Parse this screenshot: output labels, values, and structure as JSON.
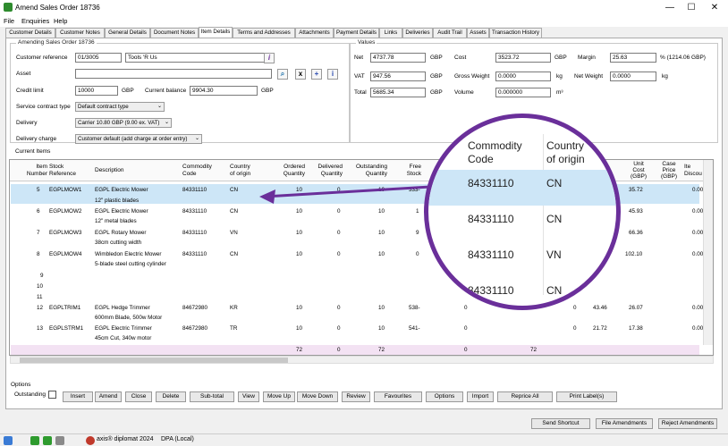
{
  "window": {
    "title": "Amend Sales Order 18736",
    "min": "—",
    "max": "☐",
    "close": "✕"
  },
  "menu": [
    "File",
    "Enquiries",
    "Help"
  ],
  "tabs": [
    "Customer Details",
    "Customer Notes",
    "General Details",
    "Document Notes",
    "Item Details",
    "Terms and Addresses",
    "Attachments",
    "Payment Details",
    "Links",
    "Deliveries",
    "Audit Trail",
    "Assets",
    "Transaction History"
  ],
  "amending": {
    "group_label": "Amending Sales Order 18736",
    "customer_reference_label": "Customer reference",
    "customer_reference": "01/3005",
    "customer_name": "Tools 'R Us",
    "asset_label": "Asset",
    "credit_limit_label": "Credit limit",
    "credit_limit": "10000",
    "credit_currency": "GBP",
    "current_balance_label": "Current balance",
    "current_balance": "9904.30",
    "balance_currency": "GBP",
    "service_contract_label": "Service contract type",
    "service_contract": "Default contract type",
    "delivery_label": "Delivery",
    "delivery": "Carrier 10.80 GBP (9.00 ex. VAT)",
    "delivery_charge_label": "Delivery charge",
    "delivery_charge": "Customer default (add charge at order entry)"
  },
  "values": {
    "group_label": "Values",
    "net_label": "Net",
    "net": "4737.78",
    "net_cur": "GBP",
    "vat_label": "VAT",
    "vat": "947.56",
    "vat_cur": "GBP",
    "total_label": "Total",
    "total": "5685.34",
    "total_cur": "GBP",
    "cost_label": "Cost",
    "cost": "3523.72",
    "cost_cur": "GBP",
    "gross_weight_label": "Gross Weight",
    "gross_weight": "0.0000",
    "gross_unit": "kg",
    "volume_label": "Volume",
    "volume": "0.000000",
    "volume_unit": "m³",
    "margin_label": "Margin",
    "margin": "25.63",
    "margin_extra": "% (1214.06 GBP)",
    "net_weight_label": "Net Weight",
    "net_weight": "0.0000",
    "net_unit": "kg"
  },
  "grid": {
    "label": "Current Items",
    "headers": {
      "item": "Item\nNumber",
      "stock": "Stock\nReference",
      "desc": "Description",
      "commodity": "Commodity\nCode",
      "country": "Country\nof origin",
      "ordered": "Ordered\nQuantity",
      "delivered": "Delivered\nQuantity",
      "outstanding": "Outstanding\nQuantity",
      "free": "Free\nStock",
      "unitcost": "Unit\nCost\n(GBP)",
      "caseprice": "Case\nPrice\n(GBP)",
      "disc": "Ite\nDiscou"
    },
    "rows": [
      {
        "n": "5",
        "ref": "EGPLMOW1",
        "d1": "EGPL Electric Mower",
        "d2": "12\" plastic blades",
        "cc": "84331110",
        "co": "CN",
        "oq": "10",
        "dq": "0",
        "osq": "10",
        "fs": "333-",
        "uc": "35.72",
        "disc": "0.00"
      },
      {
        "n": "6",
        "ref": "EGPLMOW2",
        "d1": "EGPL Electric Mower",
        "d2": "12\" metal blades",
        "cc": "84331110",
        "co": "CN",
        "oq": "10",
        "dq": "0",
        "osq": "10",
        "fs": "1",
        "uc": "45.93",
        "disc": "0.00"
      },
      {
        "n": "7",
        "ref": "EGPLMOW3",
        "d1": "EGPL Rotary Mower",
        "d2": "38cm cutting width",
        "cc": "84331110",
        "co": "VN",
        "oq": "10",
        "dq": "0",
        "osq": "10",
        "fs": "9",
        "uc": "66.36",
        "disc": "0.00"
      },
      {
        "n": "8",
        "ref": "EGPLMOW4",
        "d1": "Wimbledon Electric Mower",
        "d2": "5-blade steel cutting cylinder",
        "cc": "84331110",
        "co": "CN",
        "oq": "10",
        "dq": "0",
        "osq": "10",
        "fs": "0",
        "uc": "102.10",
        "disc": "0.00"
      },
      {
        "n": "9"
      },
      {
        "n": "10"
      },
      {
        "n": "11"
      },
      {
        "n": "12",
        "ref": "EGPLTRIM1",
        "d1": "EGPL Hedge Trimmer",
        "d2": "600mm Blade, 500w Motor",
        "cc": "84672980",
        "co": "KR",
        "oq": "10",
        "dq": "0",
        "osq": "10",
        "fs": "538-",
        "x1": "0",
        "x2": "0",
        "x3": "43.46",
        "uc": "26.07",
        "disc": "0.00"
      },
      {
        "n": "13",
        "ref": "EGPLSTRM1",
        "d1": "EGPL Electric Trimmer",
        "d2": "45cm Cut, 340w motor",
        "cc": "84672980",
        "co": "TR",
        "oq": "10",
        "dq": "0",
        "osq": "10",
        "fs": "541-",
        "x1": "0",
        "x2": "0",
        "x3": "21.72",
        "uc": "17.38",
        "disc": "0.00"
      }
    ],
    "totals": {
      "oq": "72",
      "dq": "0",
      "osq": "72",
      "a": "0",
      "b": "72"
    }
  },
  "magnifier": {
    "h1": "Commodity\nCode",
    "h2": "Country\nof origin",
    "rows": [
      {
        "cc": "84331110",
        "co": "CN"
      },
      {
        "cc": "84331110",
        "co": "CN"
      },
      {
        "cc": "84331110",
        "co": "VN"
      },
      {
        "cc": "84331110",
        "co": "CN"
      }
    ],
    "accent": "#6a2f9a"
  },
  "options": {
    "label": "Options",
    "outstanding": "Outstanding",
    "buttons": [
      "Insert",
      "Amend",
      "Close",
      "Delete",
      "Sub-total",
      "View",
      "Move Up",
      "Move Down",
      "Review",
      "Favourites",
      "Options",
      "Import",
      "Reprice All",
      "Print Label(s)"
    ]
  },
  "bottom_buttons": [
    "Send Shortcut",
    "File Amendments",
    "Reject Amendments"
  ],
  "status": {
    "app": "axis® diplomat 2024",
    "db": "DPA (Local)"
  }
}
